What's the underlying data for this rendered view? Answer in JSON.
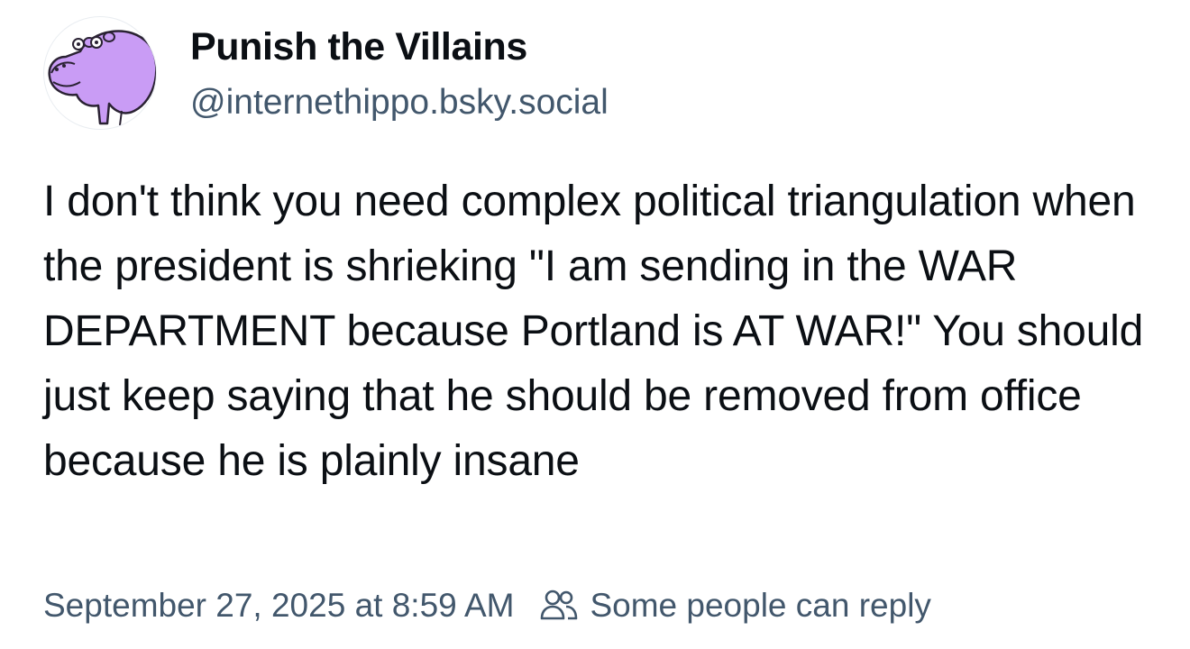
{
  "post": {
    "author": {
      "display_name": "Punish the Villains",
      "handle": "@internethippo.bsky.social",
      "avatar_icon": "purple-hippo-avatar"
    },
    "text": "I don't think you need complex political triangulation when the president is shrieking \"I am sending in the WAR DEPARTMENT because Portland is AT WAR!\" You should just keep saying that he should be removed from office because he is plainly insane",
    "timestamp": "September 27, 2025 at 8:59 AM",
    "reply_setting": {
      "icon": "people-icon",
      "label": "Some people can reply"
    }
  },
  "colors": {
    "text": "#0b0f14",
    "secondary_text": "#42576c",
    "avatar_fill": "#c99cf5",
    "background": "#ffffff"
  }
}
